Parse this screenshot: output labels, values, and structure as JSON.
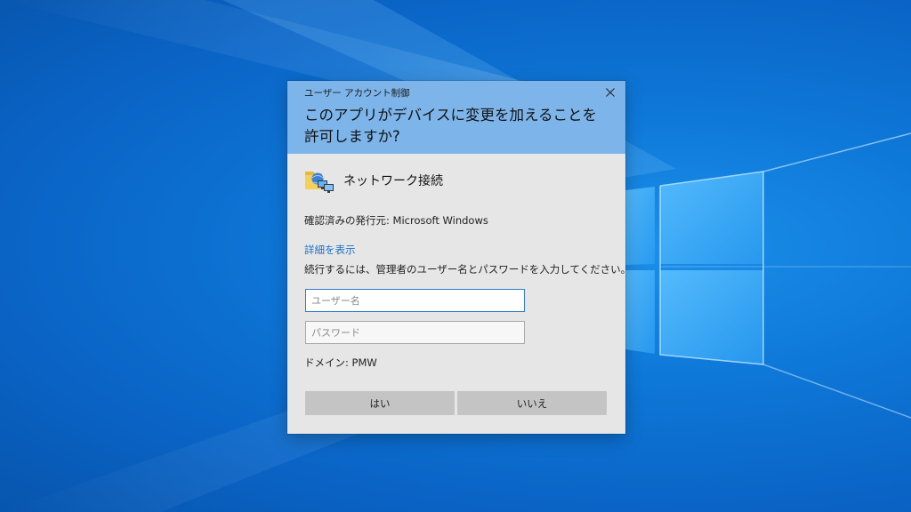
{
  "desktop": {
    "wallpaper": "windows-10-light-beam",
    "colors": {
      "wallpaper_base": "#0a64c6",
      "dialog_header": "#7db5eb",
      "dialog_body": "#e6e6e6",
      "link": "#1a6fc4",
      "button": "#c4c4c4"
    }
  },
  "uac_dialog": {
    "caption": "ユーザー アカウント制御",
    "close_icon": "close-icon",
    "title": "このアプリがデバイスに変更を加えることを許可しますか?",
    "app": {
      "icon": "network-connections-icon",
      "name": "ネットワーク接続"
    },
    "publisher": "確認済みの発行元: Microsoft Windows",
    "details_link": "詳細を表示",
    "instruction": "続行するには、管理者のユーザー名とパスワードを入力してください。",
    "username_field": {
      "value": "",
      "placeholder": "ユーザー名"
    },
    "password_field": {
      "value": "",
      "placeholder": "パスワード"
    },
    "domain": "ドメイン: PMW",
    "yes_button": "はい",
    "no_button": "いいえ"
  }
}
